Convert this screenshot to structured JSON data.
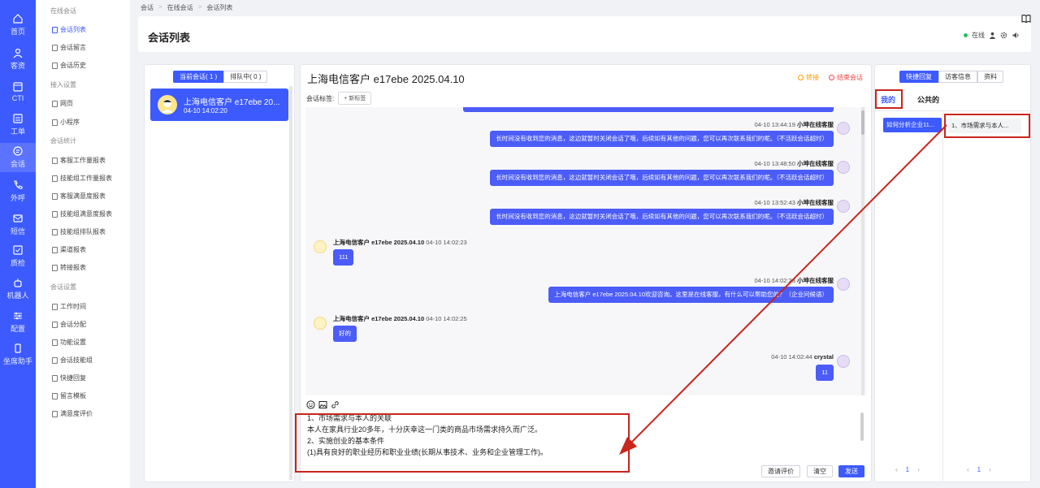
{
  "iconbar": {
    "items": [
      {
        "label": "首页",
        "icon": "home-icon"
      },
      {
        "label": "客资",
        "icon": "users-icon"
      },
      {
        "label": "CTI",
        "icon": "cti-icon"
      },
      {
        "label": "工单",
        "icon": "ticket-icon"
      },
      {
        "label": "会话",
        "icon": "chat-icon"
      },
      {
        "label": "外呼",
        "icon": "phone-icon"
      },
      {
        "label": "短信",
        "icon": "sms-icon"
      },
      {
        "label": "质检",
        "icon": "inspect-icon"
      },
      {
        "label": "机器人",
        "icon": "robot-icon"
      },
      {
        "label": "配置",
        "icon": "sliders-icon"
      },
      {
        "label": "坐席助手",
        "icon": "assistant-icon"
      }
    ],
    "active": "会话"
  },
  "subnav": {
    "groups": [
      "在线会话",
      "接入设置",
      "会话统计",
      "会话设置"
    ],
    "online": [
      "会话列表",
      "会话留言",
      "会话历史"
    ],
    "access": [
      "网页",
      "小程序"
    ],
    "stats": [
      "客服工作量报表",
      "技能组工作量报表",
      "客服满意度报表",
      "技能组满意度报表",
      "技能组排队报表",
      "渠道报表",
      "转接报表"
    ],
    "settings": [
      "工作时间",
      "会话分配",
      "功能设置",
      "会话技能组",
      "快捷回复",
      "留言模板",
      "满意度评价"
    ]
  },
  "breadcrumb": [
    "会话",
    "在线会话",
    "会话列表"
  ],
  "header": {
    "title": "会话列表",
    "status": "在线"
  },
  "left": {
    "tab_current": "当前会话( 1 )",
    "tab_queue": "排队中( 0 )",
    "session": {
      "name": "上海电信客户 e17ebe 20...",
      "time": "04-10 14:02:20"
    }
  },
  "chat": {
    "title": "上海电信客户 e17ebe 2025.04.10",
    "transfer": "转接",
    "end": "结束会话",
    "tag_label": "会话标签:",
    "new_tag": "+ 新标签",
    "messages": [
      {
        "meta_time": "04-10 13:44:19",
        "meta_name": "小坤在线客服",
        "text": "长时间没有收到您的消息，这边就暂时关闭会话了哦，后续如有其他的问题，您可以再次联系我们的呢。（不活跃会话超时）"
      },
      {
        "meta_time": "04-10 13:48:50",
        "meta_name": "小坤在线客服",
        "text": "长时间没有收到您的消息，这边就暂时关闭会话了哦，后续如有其他的问题，您可以再次联系我们的呢。（不活跃会话超时）"
      },
      {
        "meta_time": "04-10 13:52:43",
        "meta_name": "小坤在线客服",
        "text": "长时间没有收到您的消息，这边就暂时关闭会话了哦，后续如有其他的问题，您可以再次联系我们的呢。（不活跃会话超时）"
      },
      {
        "meta_name": "上海电信客户 e17ebe 2025.04.10",
        "meta_time": "04-10 14:02:23",
        "text": "111"
      },
      {
        "meta_time": "04-10 14:02:23",
        "meta_name": "小坤在线客服",
        "text": "上海电信客户 e17ebe 2025.04.10欢迎咨询。这里是在线客服，有什么可以帮助您的？（企业问候语）"
      },
      {
        "meta_name": "上海电信客户 e17ebe 2025.04.10",
        "meta_time": "04-10 14:02:25",
        "text": "好的"
      },
      {
        "meta_time": "04-10 14:02:44",
        "meta_name": "crystal",
        "text": "11"
      }
    ],
    "input_lines": [
      "1、市场需求与本人的关联",
      "本人在家具行业20多年，十分庆幸这一门类的商品市场需求持久而广泛。",
      "2、实施创业的基本条件",
      "(1)具有良好的职业经历和职业业绩(长期从事技术、业务和企业管理工作)。"
    ],
    "btn_invite": "邀请评价",
    "btn_clear": "清空",
    "btn_send": "发送"
  },
  "right": {
    "tabs": [
      "快捷回复",
      "访客信息",
      "资料"
    ],
    "sub_mine": "我的",
    "sub_public": "公共的",
    "category": "如何分析企业11...",
    "reply": "1、市场需求与本人...",
    "page": "1"
  }
}
